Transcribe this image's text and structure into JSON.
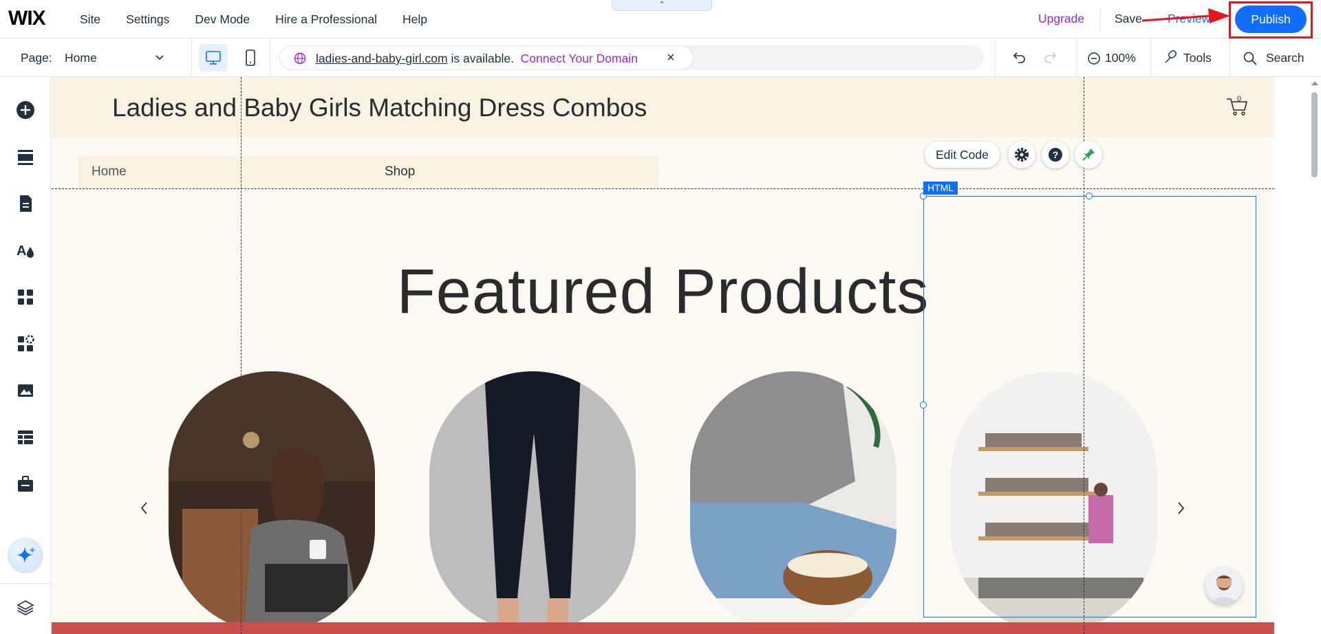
{
  "app": {
    "logo": "WIX",
    "menu": [
      "Site",
      "Settings",
      "Dev Mode",
      "Hire a Professional",
      "Help"
    ],
    "collapse_glyph": "⌃",
    "upgrade_label": "Upgrade",
    "save_label": "Save",
    "preview_label": "Preview",
    "publish_label": "Publish"
  },
  "toolbar": {
    "page_label": "Page:",
    "page_value": "Home",
    "domain": {
      "name": "ladies-and-baby-girl.com",
      "availability": " is available.",
      "connect_label": "Connect Your Domain",
      "close_glyph": "×"
    },
    "zoom_label": "100%",
    "tools_label": "Tools",
    "search_label": "Search"
  },
  "leftbar": {
    "icons": [
      "add-icon",
      "sections-icon",
      "pages-icon",
      "design-icon",
      "apps-icon",
      "business-apps-icon",
      "media-icon",
      "cms-icon",
      "portfolio-icon",
      "ai-assistant-icon",
      "layers-icon"
    ]
  },
  "site": {
    "title": "Ladies and Baby Girls Matching Dress Combos",
    "cart_count": "0",
    "nav": [
      "Home",
      "Shop"
    ],
    "featured_heading": "Featured Products"
  },
  "selection": {
    "tag": "HTML",
    "edit_code_label": "Edit Code"
  },
  "colors": {
    "accent": "#116dff",
    "upgrade": "#9a27d5",
    "annotation": "#e8141a",
    "site_header_bg": "#f8f2e4",
    "site_bg": "#fcfaf3",
    "pin_green": "#2aa44f"
  }
}
